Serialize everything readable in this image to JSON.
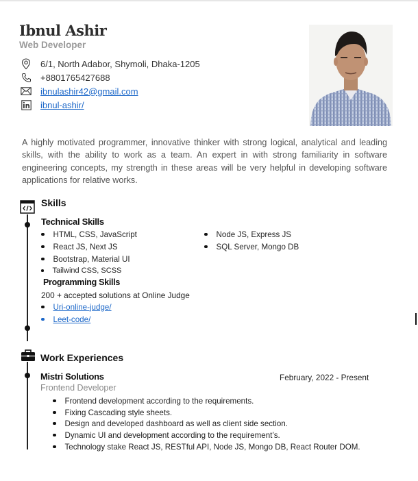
{
  "header": {
    "name": "Ibnul Ashir",
    "role": "Web Developer"
  },
  "contacts": {
    "address": {
      "icon": "location-icon",
      "text": "6/1, North Adabor, Shymoli, Dhaka-1205"
    },
    "phone": {
      "icon": "phone-icon",
      "text": "+8801765427688"
    },
    "email": {
      "icon": "email-icon",
      "text": "ibnulashir42@gmail.com"
    },
    "linkedin": {
      "icon": "linkedin-icon",
      "text": "ibnul-ashir/"
    }
  },
  "summary": "A highly motivated programmer, innovative thinker with strong logical, analytical and leading skills, with the ability to work as a team. An expert in with strong familiarity in software engineering concepts, my strength in these areas will be very helpful in developing software applications for relative works.",
  "skills": {
    "title": "Skills",
    "icon": "code-window-icon",
    "technical": {
      "title": "Technical Skills",
      "left": [
        "HTML, CSS, JavaScript",
        "React JS, Next JS",
        "Bootstrap, Material UI",
        "Tailwind CSS, SCSS"
      ],
      "right": [
        "Node JS, Express JS",
        "SQL Server, Mongo DB"
      ]
    },
    "programming": {
      "title": "Programming Skills",
      "text": "200 + accepted solutions at Online Judge",
      "links": [
        "Uri-online-judge/",
        "Leet-code/"
      ]
    }
  },
  "work": {
    "title": "Work Experiences",
    "icon": "briefcase-icon",
    "jobs": [
      {
        "company": "Mistri Solutions",
        "date": "February, 2022 - Present",
        "position": "Frontend Developer",
        "points": [
          "Frontend development according to the requirements.",
          "Fixing Cascading style sheets.",
          "Design and developed dashboard as well as client side section.",
          "Dynamic UI and development according to the requirement’s.",
          "Technology stake React JS, RESTful API, Node JS, Mongo DB, React Router DOM."
        ]
      }
    ]
  }
}
